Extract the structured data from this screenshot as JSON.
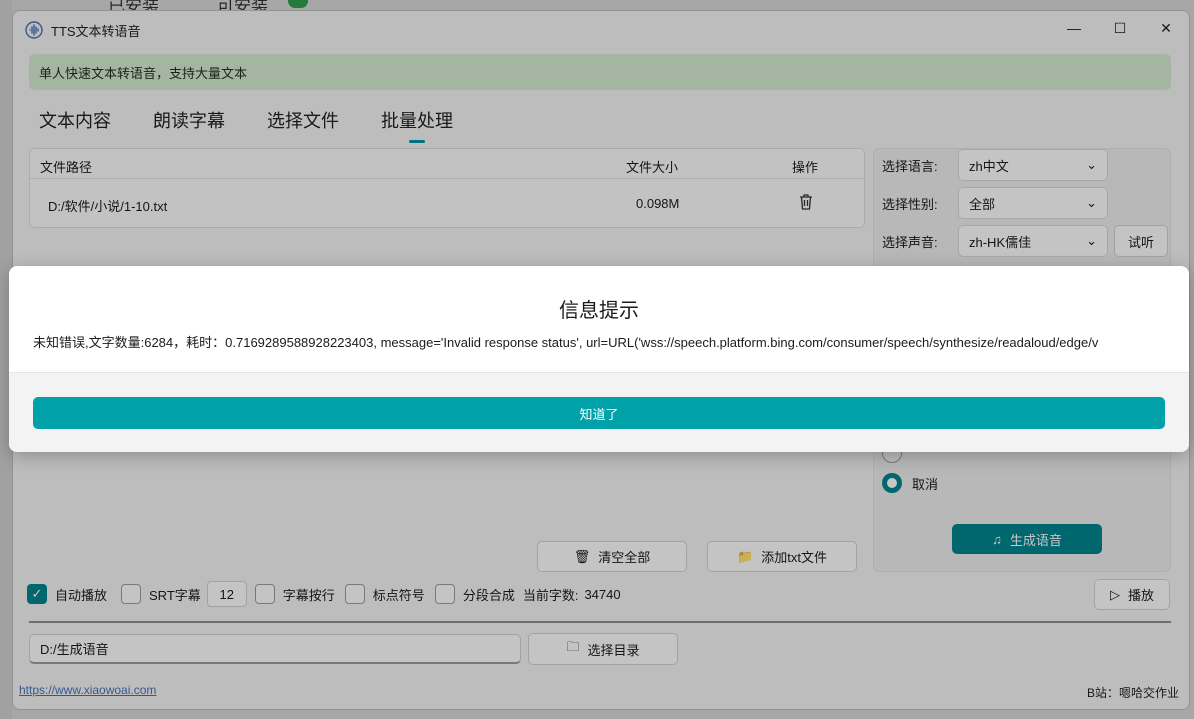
{
  "background": {
    "tabs": [
      "已安装",
      "可安装"
    ]
  },
  "window": {
    "title": "TTS文本转语音",
    "controls": {
      "minimize": "—",
      "maximize": "☐",
      "close": "✕"
    }
  },
  "infobar": {
    "text": "单人快速文本转语音，支持大量文本"
  },
  "tabs": [
    {
      "label": "文本内容"
    },
    {
      "label": "朗读字幕"
    },
    {
      "label": "选择文件"
    },
    {
      "label": "批量处理"
    }
  ],
  "file_table": {
    "headers": {
      "path": "文件路径",
      "size": "文件大小",
      "action": "操作"
    },
    "rows": [
      {
        "path": "D:/软件/小说/1-10.txt",
        "size": "0.098M"
      }
    ]
  },
  "settings": {
    "language": {
      "label": "选择语言:",
      "value": "zh中文"
    },
    "gender": {
      "label": "选择性别:",
      "value": "全部"
    },
    "voice": {
      "label": "选择声音:",
      "value": "zh-HK儒佳",
      "preview_button": "试听"
    },
    "cancel_radio": "取消",
    "generate_button": "生成语音"
  },
  "actions": {
    "clear_all": "清空全部",
    "add_txt": "添加txt文件"
  },
  "options": {
    "autoplay": "自动播放",
    "srt": "SRT字幕",
    "srt_value": "12",
    "wrap": "字幕按行",
    "punct": "标点符号",
    "segment": "分段合成",
    "count_label": "当前字数:",
    "count_value": "34740",
    "play_button": "播放"
  },
  "output": {
    "path": "D:/生成语音",
    "choose_dir_button": "选择目录"
  },
  "footer": {
    "link": "https://www.xiaowoai.com",
    "credit": "B站：嗯哈交作业"
  },
  "dialog": {
    "title": "信息提示",
    "message": "未知错误,文字数量:6284，耗时：0.7169289588928223403, message='Invalid response status', url=URL('wss://speech.platform.bing.com/consumer/speech/synthesize/readaloud/edge/v",
    "ok_button": "知道了"
  },
  "colors": {
    "accent": "#00858f",
    "dialog_button": "#00a1a8",
    "infobar": "#d3e8cf"
  }
}
